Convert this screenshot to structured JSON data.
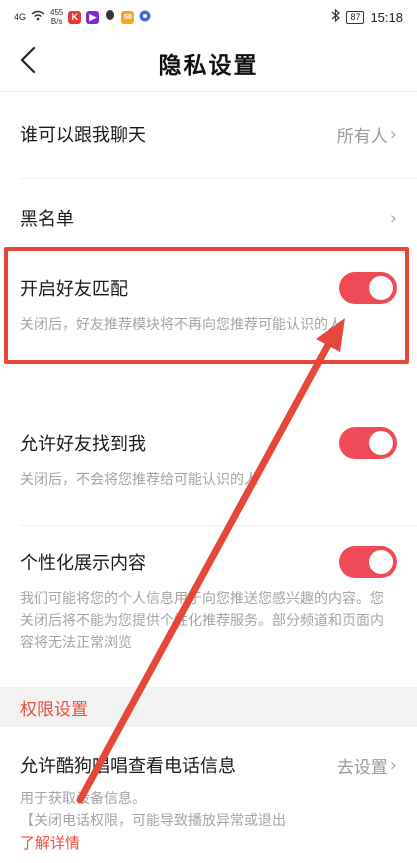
{
  "status_bar": {
    "signal": "4G",
    "net_speed": "455",
    "net_speed_unit": "B/s",
    "battery": "87",
    "time": "15:18"
  },
  "header": {
    "title": "隐私设置"
  },
  "rows": {
    "who_can_chat": {
      "label": "谁可以跟我聊天",
      "value": "所有人"
    },
    "blacklist": {
      "label": "黑名单"
    },
    "friend_match": {
      "label": "开启好友匹配",
      "desc": "关闭后，好友推荐模块将不再向您推荐可能认识的人",
      "enabled": true
    },
    "find_me": {
      "label": "允许好友找到我",
      "desc": "关闭后，不会将您推荐给可能认识的人",
      "enabled": true
    },
    "personalized": {
      "label": "个性化展示内容",
      "desc": "我们可能将您的个人信息用于向您推送您感兴趣的内容。您关闭后将不能为您提供个性化推荐服务。部分频道和页面内容将无法正常浏览",
      "enabled": true
    }
  },
  "permissions": {
    "section_title": "权限设置",
    "phone_info": {
      "label": "允许酷狗唱唱查看电话信息",
      "value": "去设置",
      "desc1": "用于获取设备信息。",
      "desc2": "【关闭电话权限，可能导致播放异常或退出",
      "link": "了解详情"
    }
  },
  "colors": {
    "accent": "#f04a56",
    "annotation": "#e5473b",
    "section_text": "#e8513f"
  }
}
